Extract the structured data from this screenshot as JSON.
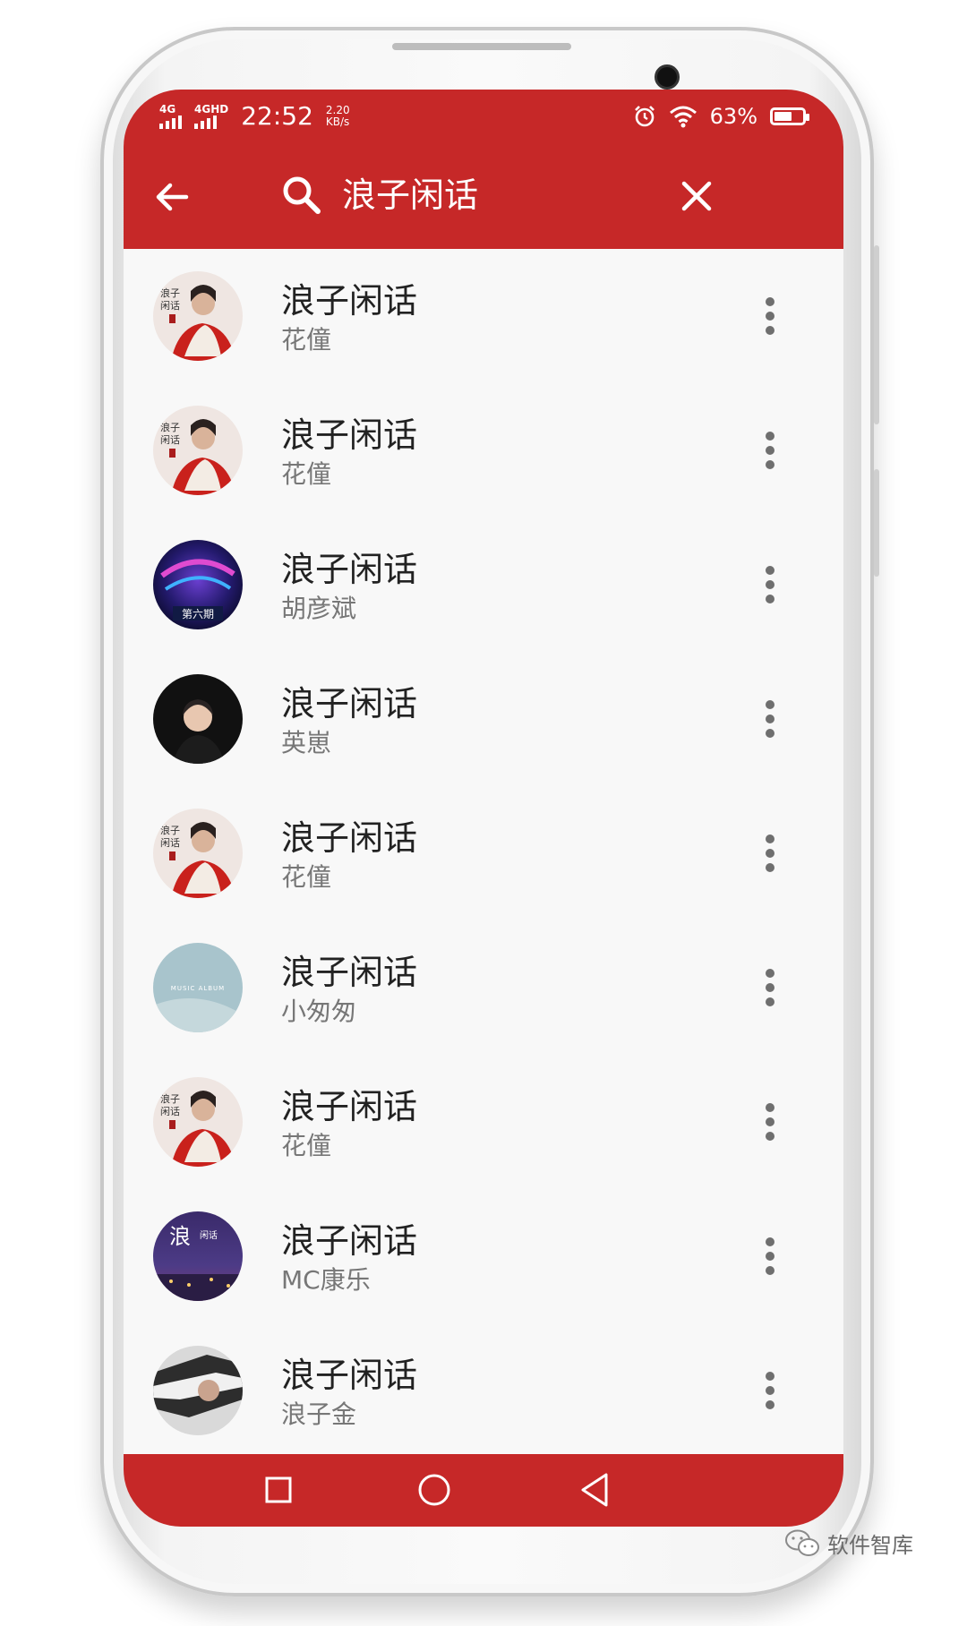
{
  "status_bar": {
    "signal1_label": "4G",
    "signal2_label": "4GHD",
    "time": "22:52",
    "speed_value": "2.20",
    "speed_unit": "KB/s",
    "battery_percent": "63%",
    "battery_level": 0.63,
    "icons": [
      "alarm-icon",
      "wifi-icon",
      "battery-icon"
    ]
  },
  "app_bar": {
    "back_icon": "arrow-left-icon",
    "search_icon": "search-icon",
    "search_query": "浪子闲话",
    "close_icon": "close-icon"
  },
  "results": [
    {
      "title": "浪子闲话",
      "artist": "花僮",
      "cover": "cover-huatong"
    },
    {
      "title": "浪子闲话",
      "artist": "花僮",
      "cover": "cover-huatong"
    },
    {
      "title": "浪子闲话",
      "artist": "胡彦斌",
      "cover": "cover-huyanbin"
    },
    {
      "title": "浪子闲话",
      "artist": "英崽",
      "cover": "cover-yingzai"
    },
    {
      "title": "浪子闲话",
      "artist": "花僮",
      "cover": "cover-huatong"
    },
    {
      "title": "浪子闲话",
      "artist": "小匆匆",
      "cover": "cover-music-album"
    },
    {
      "title": "浪子闲话",
      "artist": "花僮",
      "cover": "cover-huatong"
    },
    {
      "title": "浪子闲话",
      "artist": "MC康乐",
      "cover": "cover-mckangle"
    },
    {
      "title": "浪子闲话",
      "artist": "浪子金",
      "cover": "cover-langzijin"
    }
  ],
  "cover_texts": {
    "huyanbin_caption": "第六期",
    "music_album": "MUSIC ALBUM"
  },
  "nav_bar": {
    "icons": [
      "recents-square-icon",
      "home-circle-icon",
      "back-triangle-icon"
    ]
  },
  "watermark": {
    "text": "软件智库",
    "icon": "wechat-icon"
  },
  "colors": {
    "accent": "#c62828",
    "list_background": "#f8f8f8",
    "title_text": "#222222",
    "subtitle_text": "#777777"
  }
}
